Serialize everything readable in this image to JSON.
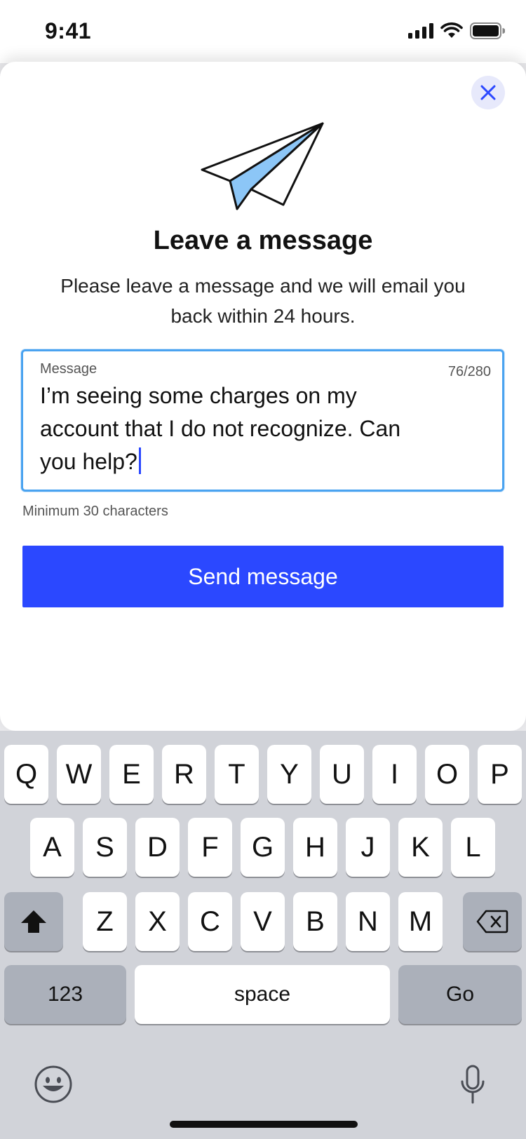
{
  "status_bar": {
    "time": "9:41"
  },
  "modal": {
    "title": "Leave a message",
    "subtitle": "Please leave a message and we will email you back within 24 hours.",
    "message_field": {
      "label": "Message",
      "counter": "76/280",
      "value": "I’m seeing some charges on my account that I do not recognize. Can you help?"
    },
    "hint": "Minimum 30 characters",
    "send_label": "Send message"
  },
  "keyboard": {
    "row1": [
      "Q",
      "W",
      "E",
      "R",
      "T",
      "Y",
      "U",
      "I",
      "O",
      "P"
    ],
    "row2": [
      "A",
      "S",
      "D",
      "F",
      "G",
      "H",
      "J",
      "K",
      "L"
    ],
    "row3": [
      "Z",
      "X",
      "C",
      "V",
      "B",
      "N",
      "M"
    ],
    "numbers_label": "123",
    "space_label": "space",
    "go_label": "Go"
  },
  "colors": {
    "accent": "#2b48ff",
    "focus_border": "#4aa3f0",
    "plane_fill": "#8cc6f7"
  }
}
